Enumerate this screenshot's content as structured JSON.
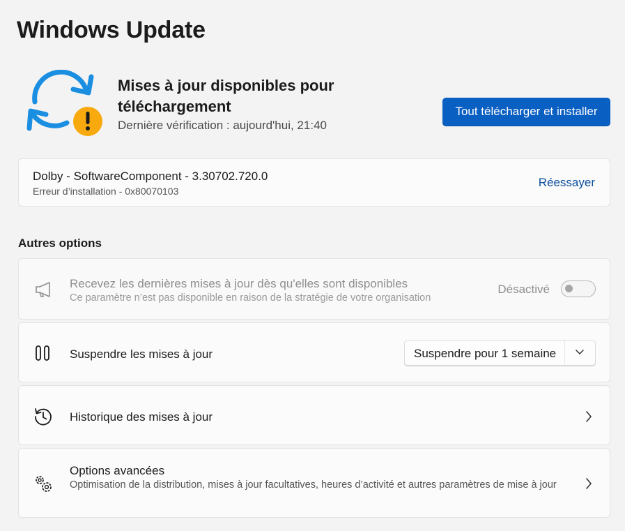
{
  "page": {
    "title": "Windows Update"
  },
  "hero": {
    "icon": "sync-warning-icon",
    "title": "Mises à jour disponibles pour téléchargement",
    "subtitle": "Dernière vérification : aujourd'hui, 21:40",
    "primary_button": "Tout télécharger et installer"
  },
  "pending_update": {
    "name": "Dolby - SoftwareComponent - 3.30702.720.0",
    "status": "Erreur d’installation - 0x80070103",
    "action": "Réessayer"
  },
  "other_options": {
    "title": "Autres options",
    "items": [
      {
        "icon": "megaphone-icon",
        "title": "Recevez les dernières mises à jour dès qu'elles sont disponibles",
        "description": "Ce paramètre n’est pas disponible en raison de la stratégie de votre organisation",
        "toggle_label": "Désactivé",
        "toggle_on": false,
        "disabled": true
      },
      {
        "icon": "pause-icon",
        "title": "Suspendre les mises à jour",
        "dropdown_value": "Suspendre pour 1 semaine"
      },
      {
        "icon": "history-icon",
        "title": "Historique des mises à jour"
      },
      {
        "icon": "gears-icon",
        "title": "Options avancées",
        "description": "Optimisation de la distribution, mises à jour facultatives, heures d’activité et autres paramètres de mise à jour"
      }
    ]
  },
  "colors": {
    "accent": "#0a5fc2",
    "warning": "#f7a90d",
    "sync_blue": "#1a8ee0"
  }
}
